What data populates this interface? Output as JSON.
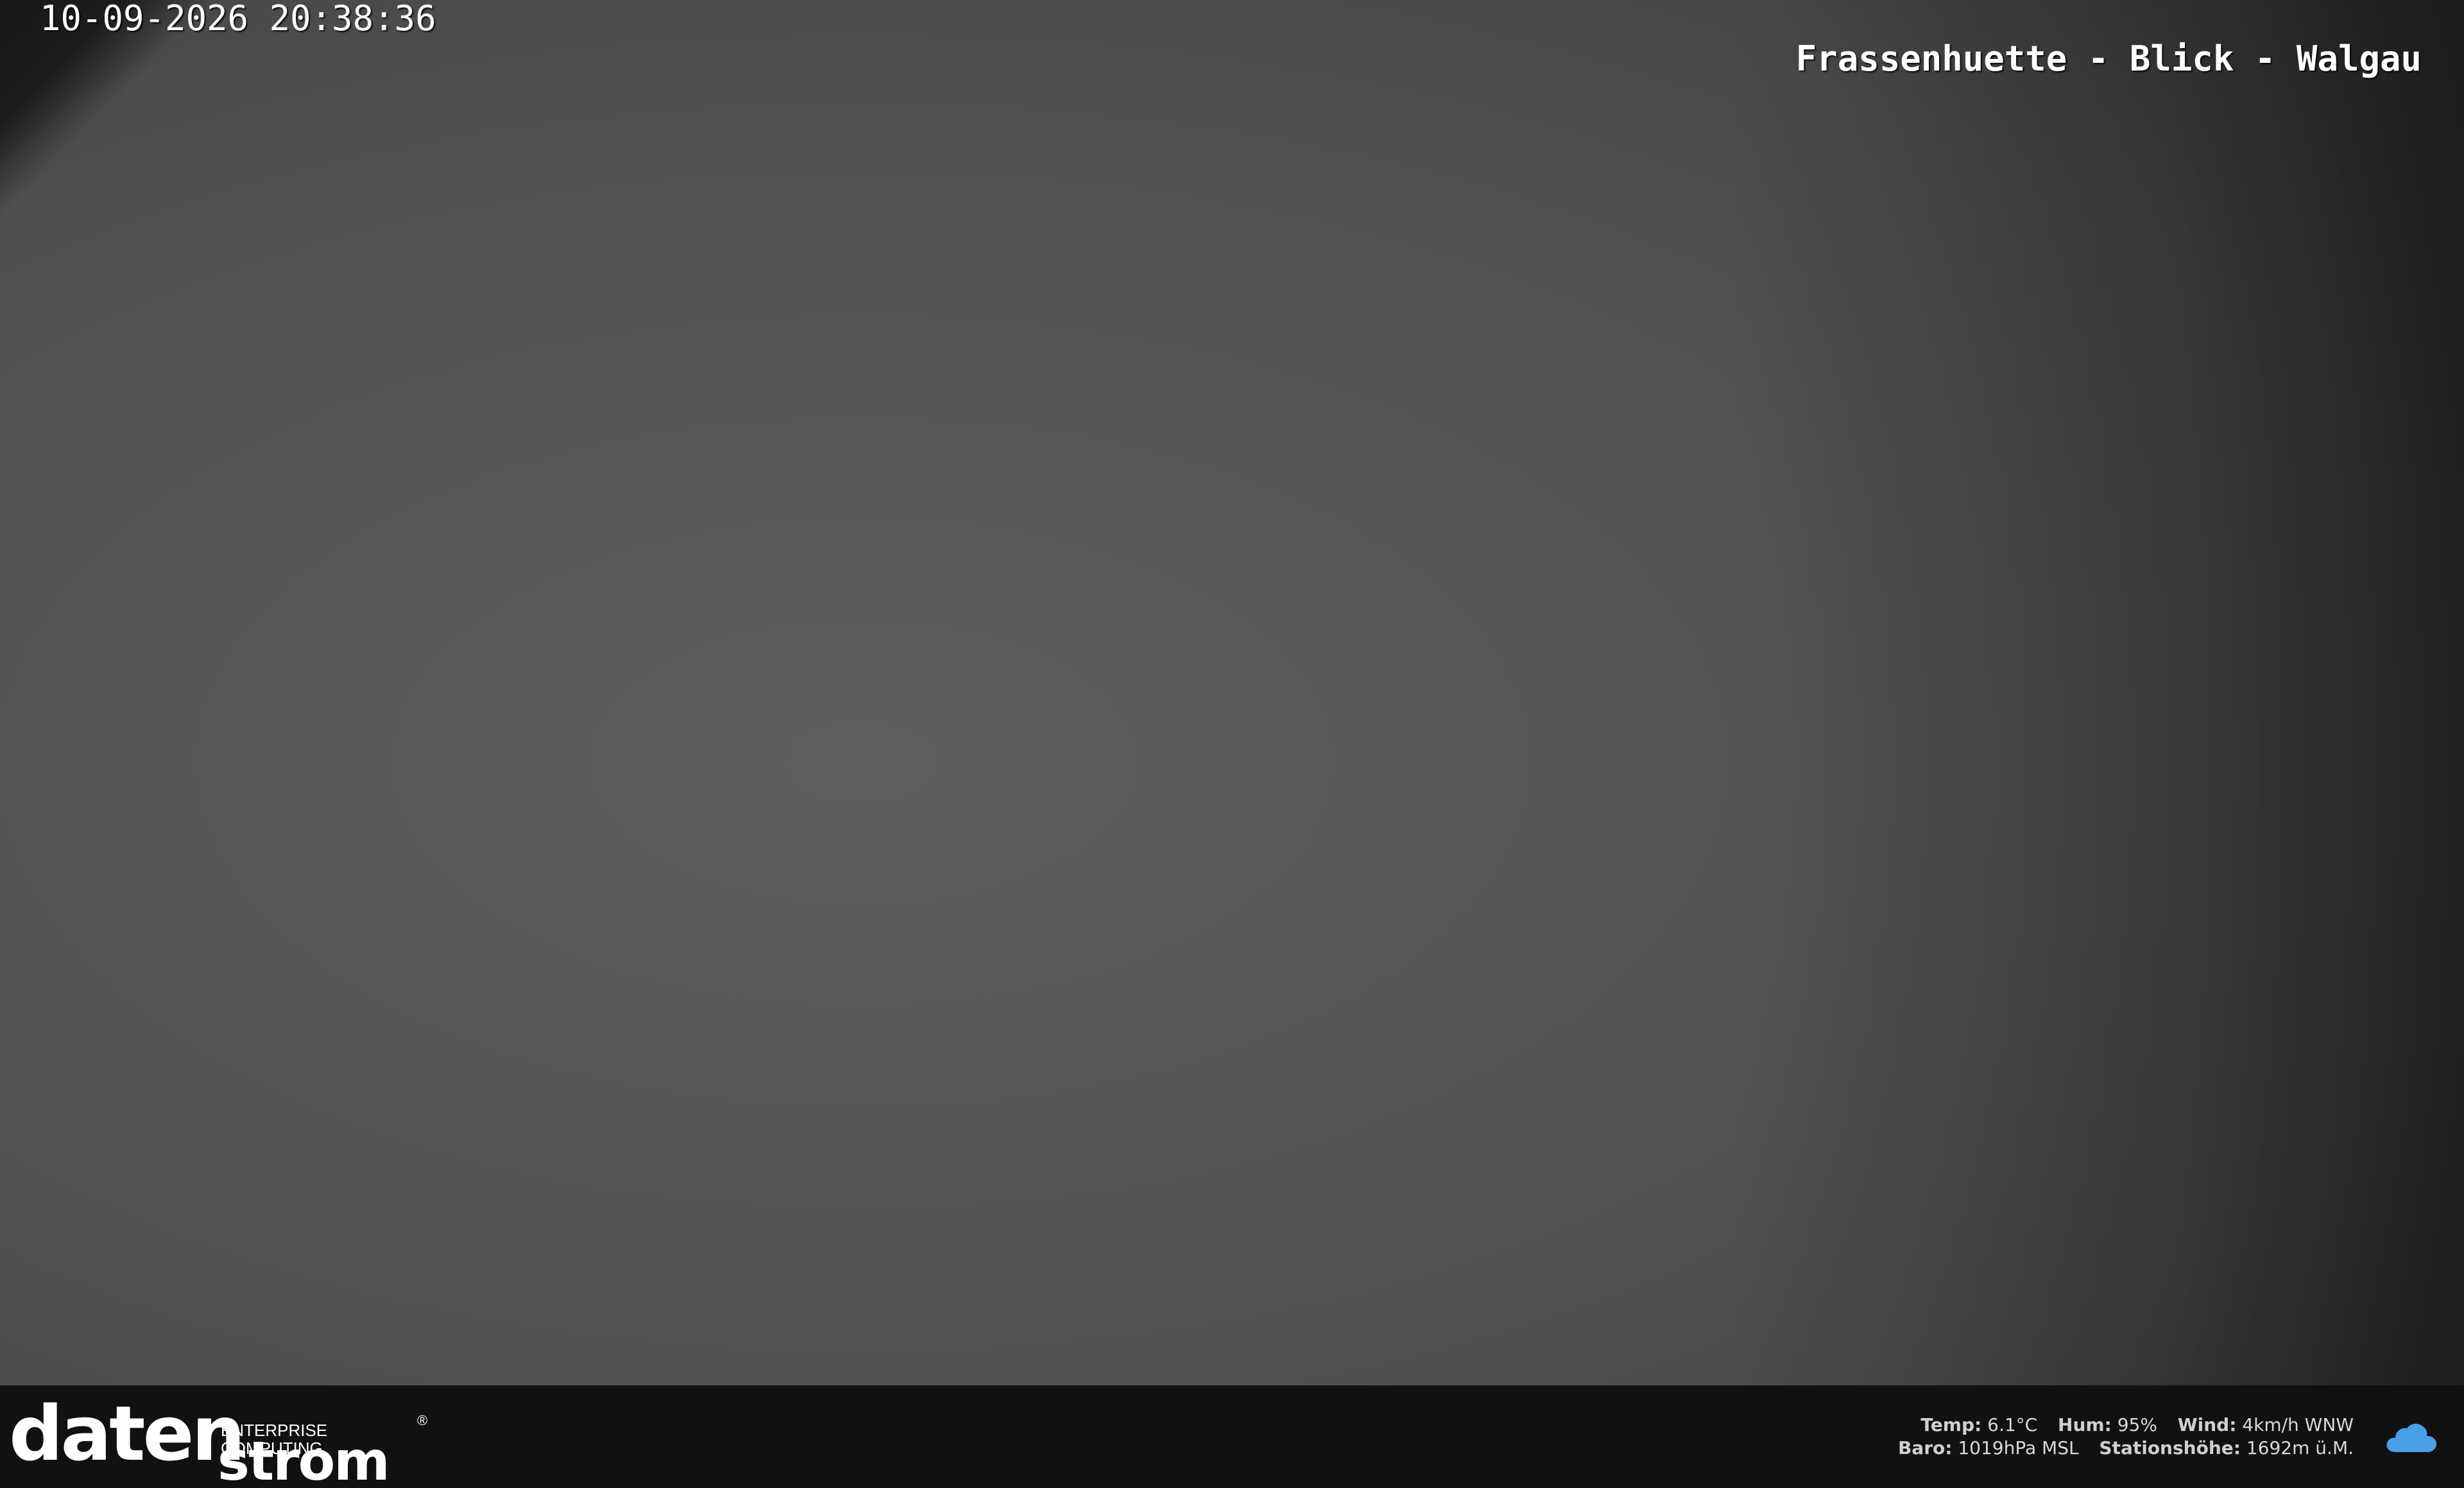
{
  "osd": {
    "timestamp": "10-09-2026 20:38:36",
    "camera_title": "Frassenhuette - Blick - Walgau"
  },
  "logo": {
    "top": "daten",
    "bottom": "strom",
    "tagline": "ENTERPRISE COMPUTING",
    "registered": "®"
  },
  "weather": {
    "temp_label": "Temp:",
    "temp_value": "6.1°C",
    "hum_label": "Hum:",
    "hum_value": "95%",
    "wind_label": "Wind:",
    "wind_value": "4km/h WNW",
    "baro_label": "Baro:",
    "baro_value": "1019hPa MSL",
    "station_label": "Stationshöhe:",
    "station_value": "1692m ü.M.",
    "icon": "cloud-icon",
    "icon_color": "#4aa0e6"
  },
  "colors": {
    "bar_background": "#111111",
    "osd_text": "#ffffff"
  }
}
